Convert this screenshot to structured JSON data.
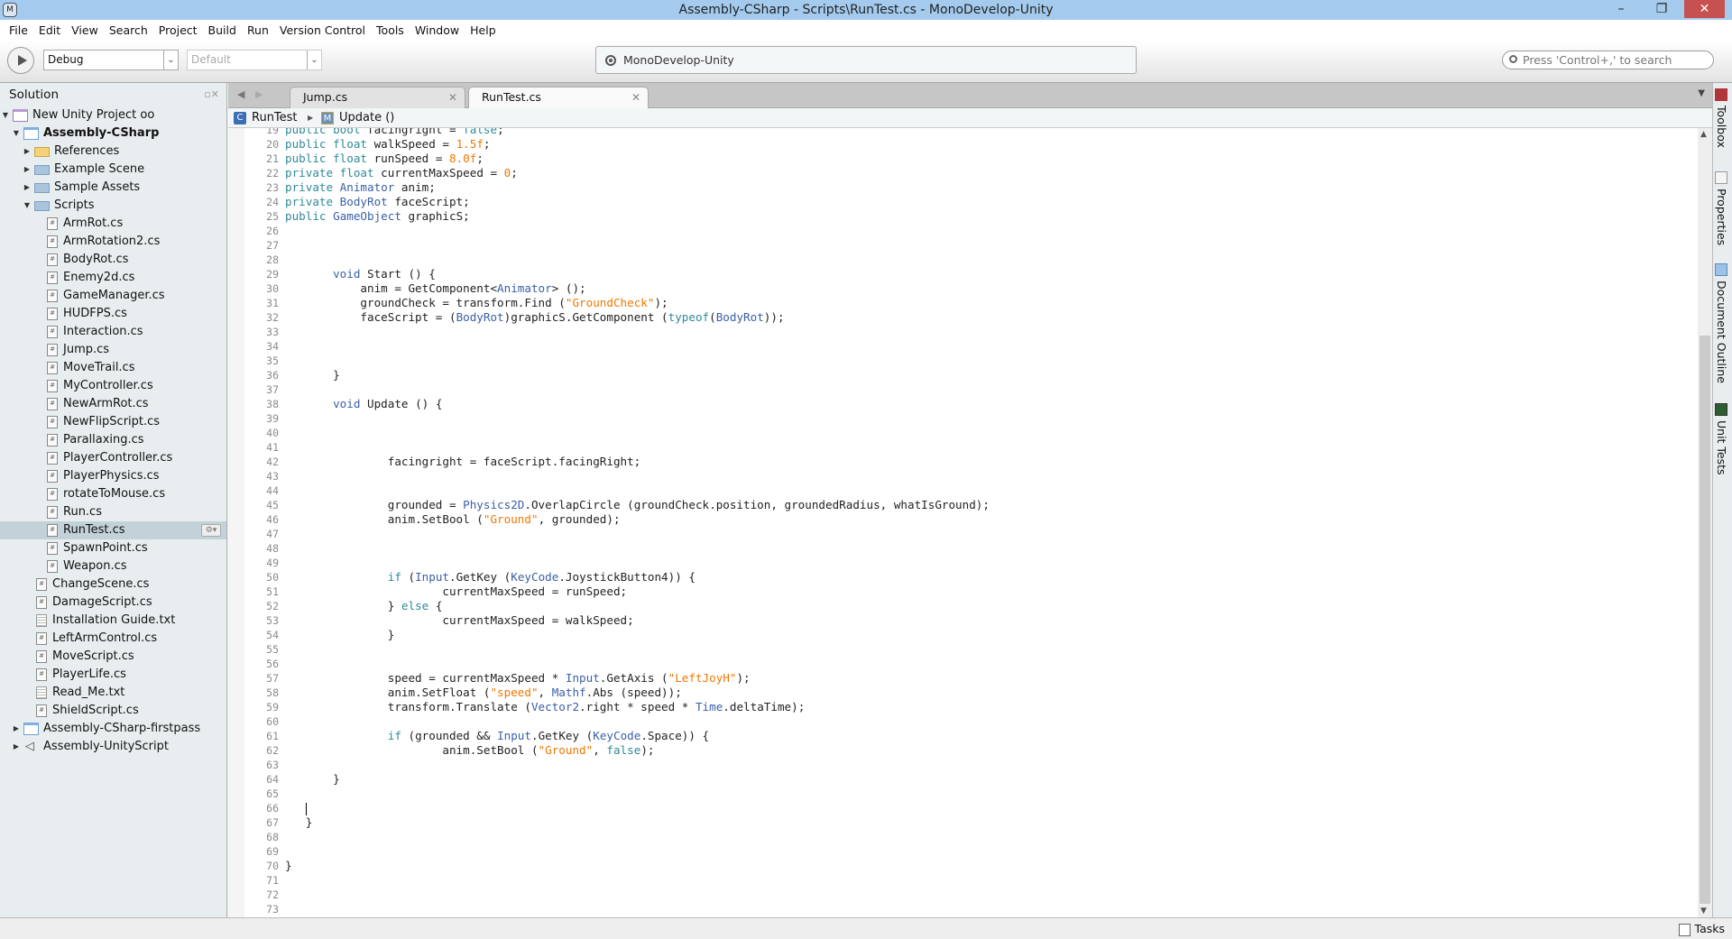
{
  "window": {
    "title": "Assembly-CSharp - Scripts\\RunTest.cs - MonoDevelop-Unity",
    "minimize": "–",
    "restore": "❐",
    "close": "✕"
  },
  "menu": [
    "File",
    "Edit",
    "View",
    "Search",
    "Project",
    "Build",
    "Run",
    "Version Control",
    "Tools",
    "Window",
    "Help"
  ],
  "toolbar": {
    "config": "Debug",
    "platform": "Default",
    "status": "MonoDevelop-Unity",
    "search_placeholder": "Press 'Control+,' to search"
  },
  "solution": {
    "title": "Solution",
    "items": [
      {
        "label": "New Unity Project oo",
        "level": 0,
        "icon": "solution",
        "expanded": true
      },
      {
        "label": "Assembly-CSharp",
        "level": 1,
        "icon": "assembly",
        "expanded": true,
        "bold": true
      },
      {
        "label": "References",
        "level": 2,
        "icon": "yellow-folder",
        "expanded": false
      },
      {
        "label": "Example Scene",
        "level": 2,
        "icon": "folder",
        "expanded": false
      },
      {
        "label": "Sample Assets",
        "level": 2,
        "icon": "folder",
        "expanded": false
      },
      {
        "label": "Scripts",
        "level": 2,
        "icon": "folder",
        "expanded": true
      },
      {
        "label": "ArmRot.cs",
        "level": 3,
        "icon": "cs"
      },
      {
        "label": "ArmRotation2.cs",
        "level": 3,
        "icon": "cs"
      },
      {
        "label": "BodyRot.cs",
        "level": 3,
        "icon": "cs"
      },
      {
        "label": "Enemy2d.cs",
        "level": 3,
        "icon": "cs"
      },
      {
        "label": "GameManager.cs",
        "level": 3,
        "icon": "cs"
      },
      {
        "label": "HUDFPS.cs",
        "level": 3,
        "icon": "cs"
      },
      {
        "label": "Interaction.cs",
        "level": 3,
        "icon": "cs"
      },
      {
        "label": "Jump.cs",
        "level": 3,
        "icon": "cs"
      },
      {
        "label": "MoveTrail.cs",
        "level": 3,
        "icon": "cs"
      },
      {
        "label": "MyController.cs",
        "level": 3,
        "icon": "cs"
      },
      {
        "label": "NewArmRot.cs",
        "level": 3,
        "icon": "cs"
      },
      {
        "label": "NewFlipScript.cs",
        "level": 3,
        "icon": "cs"
      },
      {
        "label": "Parallaxing.cs",
        "level": 3,
        "icon": "cs"
      },
      {
        "label": "PlayerController.cs",
        "level": 3,
        "icon": "cs"
      },
      {
        "label": "PlayerPhysics.cs",
        "level": 3,
        "icon": "cs"
      },
      {
        "label": "rotateToMouse.cs",
        "level": 3,
        "icon": "cs"
      },
      {
        "label": "Run.cs",
        "level": 3,
        "icon": "cs"
      },
      {
        "label": "RunTest.cs",
        "level": 3,
        "icon": "cs",
        "selected": true
      },
      {
        "label": "SpawnPoint.cs",
        "level": 3,
        "icon": "cs"
      },
      {
        "label": "Weapon.cs",
        "level": 3,
        "icon": "cs"
      },
      {
        "label": "ChangeScene.cs",
        "level": 2,
        "icon": "cs"
      },
      {
        "label": "DamageScript.cs",
        "level": 2,
        "icon": "cs"
      },
      {
        "label": "Installation Guide.txt",
        "level": 2,
        "icon": "txt"
      },
      {
        "label": "LeftArmControl.cs",
        "level": 2,
        "icon": "cs"
      },
      {
        "label": "MoveScript.cs",
        "level": 2,
        "icon": "cs"
      },
      {
        "label": "PlayerLife.cs",
        "level": 2,
        "icon": "cs"
      },
      {
        "label": "Read_Me.txt",
        "level": 2,
        "icon": "txt"
      },
      {
        "label": "ShieldScript.cs",
        "level": 2,
        "icon": "cs"
      },
      {
        "label": "Assembly-CSharp-firstpass",
        "level": 1,
        "icon": "assembly",
        "expanded": false
      },
      {
        "label": "Assembly-UnityScript",
        "level": 1,
        "icon": "unity",
        "expanded": false
      }
    ]
  },
  "tabs": [
    {
      "label": "Jump.cs",
      "active": false
    },
    {
      "label": "RunTest.cs",
      "active": true
    }
  ],
  "breadcrumb": {
    "class": "RunTest",
    "method": "Update ()"
  },
  "code": {
    "first_line": 19,
    "cursor_line": 66,
    "lines": [
      [
        [
          "public ",
          "k"
        ],
        [
          "bool ",
          "k"
        ],
        [
          "facingright = "
        ],
        [
          "false",
          "k"
        ],
        [
          ";"
        ]
      ],
      [
        [
          "public ",
          "k"
        ],
        [
          "float ",
          "k"
        ],
        [
          "walkSpeed = "
        ],
        [
          "1.5f",
          "s"
        ],
        [
          ";"
        ]
      ],
      [
        [
          "public ",
          "k"
        ],
        [
          "float ",
          "k"
        ],
        [
          "runSpeed = "
        ],
        [
          "8.0f",
          "s"
        ],
        [
          ";"
        ]
      ],
      [
        [
          "private ",
          "k"
        ],
        [
          "float ",
          "k"
        ],
        [
          "currentMaxSpeed = "
        ],
        [
          "0",
          "s"
        ],
        [
          ";"
        ]
      ],
      [
        [
          "private ",
          "k"
        ],
        [
          "Animator",
          "t"
        ],
        [
          " anim;"
        ]
      ],
      [
        [
          "private ",
          "k"
        ],
        [
          "BodyRot",
          "t"
        ],
        [
          " faceScript;"
        ]
      ],
      [
        [
          "public ",
          "k"
        ],
        [
          "GameObject",
          "t"
        ],
        [
          " graphicS;"
        ]
      ],
      [],
      [],
      [],
      [
        [
          "       "
        ],
        [
          "void",
          "t"
        ],
        [
          " Start () {"
        ]
      ],
      [
        [
          "           anim = GetComponent<"
        ],
        [
          "Animator",
          "t"
        ],
        [
          "> ();"
        ]
      ],
      [
        [
          "           groundCheck = transform.Find ("
        ],
        [
          "\"GroundCheck\"",
          "s"
        ],
        [
          ");"
        ]
      ],
      [
        [
          "           faceScript = ("
        ],
        [
          "BodyRot",
          "t"
        ],
        [
          ")graphicS.GetComponent ("
        ],
        [
          "typeof",
          "k"
        ],
        [
          "("
        ],
        [
          "BodyRot",
          "t"
        ],
        [
          "));"
        ]
      ],
      [],
      [],
      [],
      [
        [
          "       }"
        ]
      ],
      [],
      [
        [
          "       "
        ],
        [
          "void",
          "t"
        ],
        [
          " Update () {"
        ]
      ],
      [],
      [],
      [],
      [
        [
          "               facingright = faceScript.facingRight;"
        ]
      ],
      [],
      [],
      [
        [
          "               grounded = "
        ],
        [
          "Physics2D",
          "t"
        ],
        [
          ".OverlapCircle (groundCheck.position, groundedRadius, whatIsGround);"
        ]
      ],
      [
        [
          "               anim.SetBool ("
        ],
        [
          "\"Ground\"",
          "s"
        ],
        [
          ", grounded);"
        ]
      ],
      [],
      [],
      [],
      [
        [
          "               "
        ],
        [
          "if",
          "k"
        ],
        [
          " ("
        ],
        [
          "Input",
          "t"
        ],
        [
          ".GetKey ("
        ],
        [
          "KeyCode",
          "t"
        ],
        [
          ".JoystickButton4)) {"
        ]
      ],
      [
        [
          "                       currentMaxSpeed = runSpeed;"
        ]
      ],
      [
        [
          "               } "
        ],
        [
          "else",
          "k"
        ],
        [
          " {"
        ]
      ],
      [
        [
          "                       currentMaxSpeed = walkSpeed;"
        ]
      ],
      [
        [
          "               }"
        ]
      ],
      [],
      [],
      [
        [
          "               speed = currentMaxSpeed * "
        ],
        [
          "Input",
          "t"
        ],
        [
          ".GetAxis ("
        ],
        [
          "\"LeftJoyH\"",
          "s"
        ],
        [
          ");"
        ]
      ],
      [
        [
          "               anim.SetFloat ("
        ],
        [
          "\"speed\"",
          "s"
        ],
        [
          ", "
        ],
        [
          "Mathf",
          "t"
        ],
        [
          ".Abs (speed));"
        ]
      ],
      [
        [
          "               transform.Translate ("
        ],
        [
          "Vector2",
          "t"
        ],
        [
          ".right * speed * "
        ],
        [
          "Time",
          "t"
        ],
        [
          ".deltaTime);"
        ]
      ],
      [],
      [
        [
          "               "
        ],
        [
          "if",
          "k"
        ],
        [
          " (grounded && "
        ],
        [
          "Input",
          "t"
        ],
        [
          ".GetKey ("
        ],
        [
          "KeyCode",
          "t"
        ],
        [
          ".Space)) {"
        ]
      ],
      [
        [
          "                       anim.SetBool ("
        ],
        [
          "\"Ground\"",
          "s"
        ],
        [
          ", "
        ],
        [
          "false",
          "k"
        ],
        [
          ");"
        ]
      ],
      [],
      [
        [
          "       }"
        ]
      ],
      [],
      [
        [
          "   "
        ]
      ],
      [
        [
          "   }"
        ]
      ],
      [],
      [],
      [
        [
          "}"
        ]
      ],
      [],
      [],
      []
    ]
  },
  "right_pads": [
    "Toolbox",
    "Properties",
    "Document Outline",
    "Unit Tests"
  ],
  "statusbar": {
    "tasks": "Tasks"
  },
  "colors": {
    "keyword": "#2e8a99",
    "type": "#3a5fa6",
    "literal": "#f07800",
    "titlebar": "#a4cbee",
    "selection": "#c3d2d9"
  }
}
